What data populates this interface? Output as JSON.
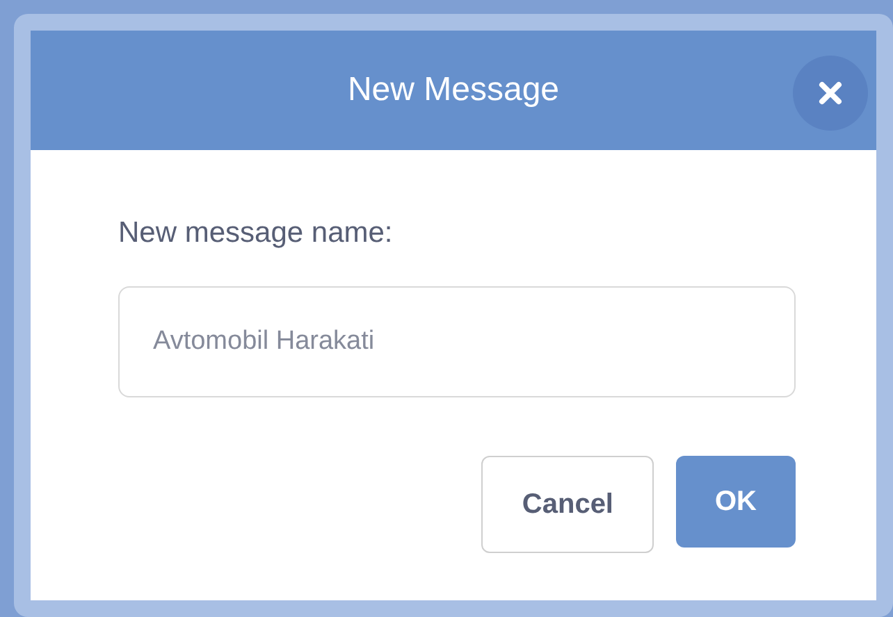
{
  "dialog": {
    "title": "New Message",
    "label": "New message name:",
    "field": {
      "value": "Avtomobil Harakati"
    },
    "buttons": [
      {
        "label": "Cancel",
        "kind": "secondary"
      },
      {
        "label": "OK",
        "kind": "primary"
      }
    ]
  }
}
